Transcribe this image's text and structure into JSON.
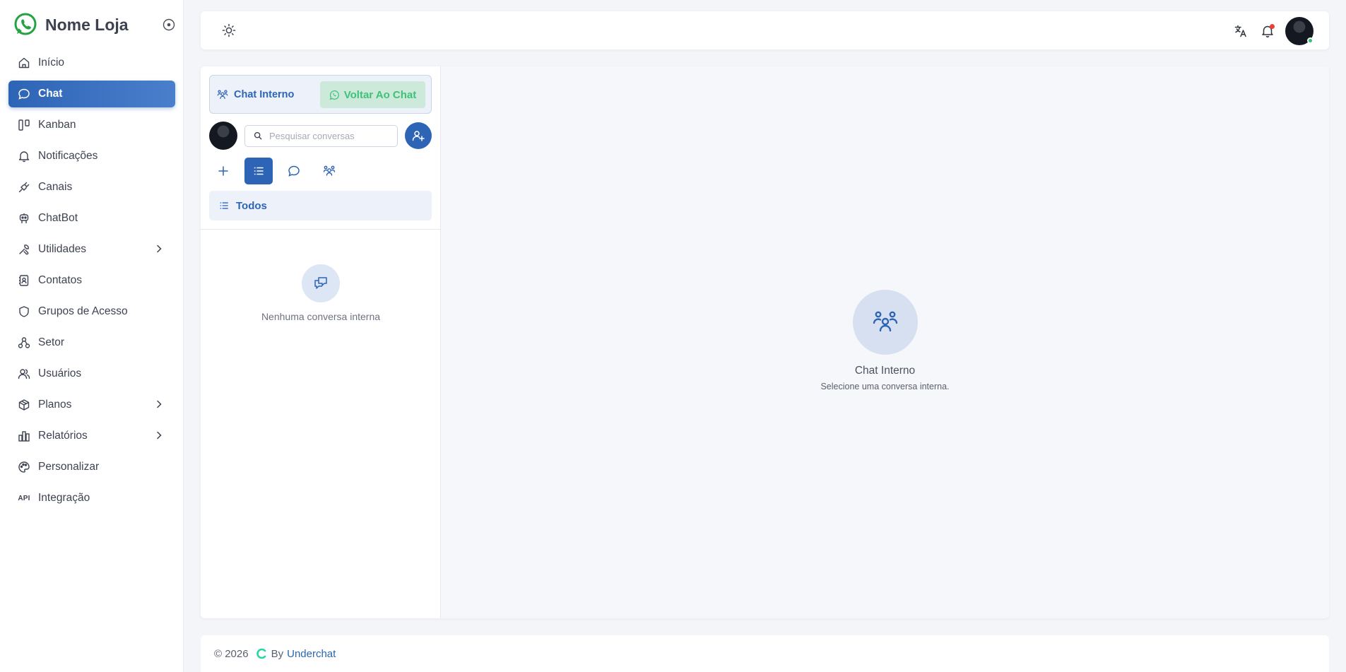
{
  "app": {
    "brand_name": "Nome Loja",
    "accent": "#2d64b5",
    "whatsapp_green": "#25d366"
  },
  "sidebar": {
    "items": [
      {
        "label": "Início",
        "icon": "home-icon"
      },
      {
        "label": "Chat",
        "icon": "chat-icon",
        "active": true
      },
      {
        "label": "Kanban",
        "icon": "kanban-icon"
      },
      {
        "label": "Notificações",
        "icon": "bell-icon"
      },
      {
        "label": "Canais",
        "icon": "plug-icon"
      },
      {
        "label": "ChatBot",
        "icon": "robot-icon"
      },
      {
        "label": "Utilidades",
        "icon": "tools-icon",
        "has_submenu": true
      },
      {
        "label": "Contatos",
        "icon": "contacts-icon"
      },
      {
        "label": "Grupos de Acesso",
        "icon": "shield-icon"
      },
      {
        "label": "Setor",
        "icon": "sitemap-icon"
      },
      {
        "label": "Usuários",
        "icon": "users-icon"
      },
      {
        "label": "Planos",
        "icon": "package-icon",
        "has_submenu": true
      },
      {
        "label": "Relatórios",
        "icon": "bar-chart-icon",
        "has_submenu": true
      },
      {
        "label": "Personalizar",
        "icon": "palette-icon"
      },
      {
        "label": "Integração",
        "icon": "api-icon",
        "icon_text": "API"
      }
    ]
  },
  "chat": {
    "tab_internal_label": "Chat Interno",
    "tab_back_label": "Voltar Ao Chat",
    "search_placeholder": "Pesquisar conversas",
    "filter_label": "Todos",
    "empty_list_message": "Nenhuma conversa interna",
    "empty_title": "Chat Interno",
    "empty_subtitle": "Selecione uma conversa interna."
  },
  "footer": {
    "copyright": "© 2026",
    "by": "By",
    "link_text": "Underchat"
  }
}
